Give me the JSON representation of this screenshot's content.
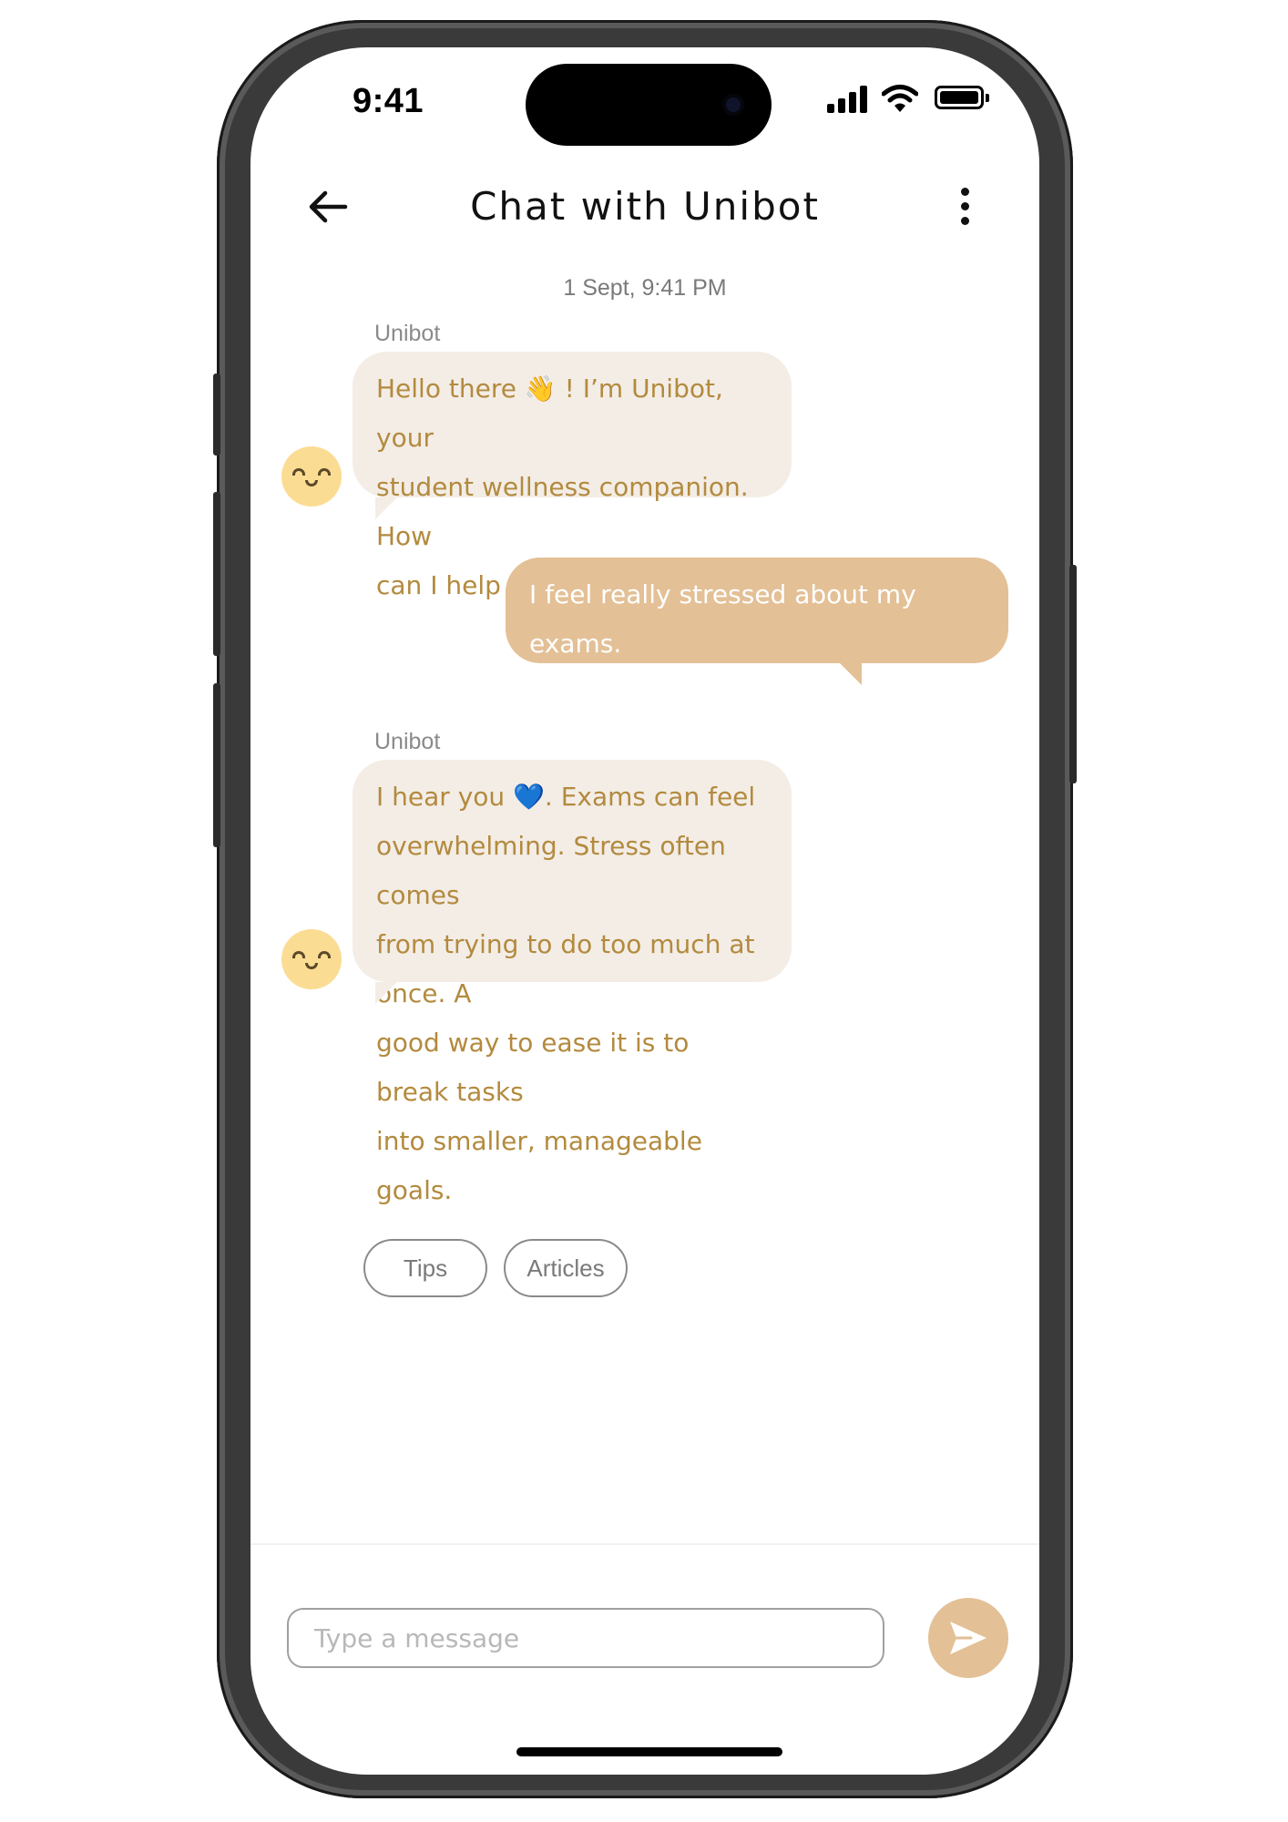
{
  "status_bar": {
    "time": "9:41"
  },
  "header": {
    "title": "Chat with Unibot"
  },
  "chat": {
    "timestamp": "1 Sept, 9:41 PM",
    "messages": [
      {
        "sender": "Unibot",
        "lines": [
          "Hello there 👋 ! I’m Unibot, your",
          "student wellness companion. How",
          "can I help you today?"
        ]
      },
      {
        "sender": "user",
        "lines": [
          "I feel really stressed about my",
          "exams."
        ]
      },
      {
        "sender": "Unibot",
        "lines": [
          "I hear you 💙. Exams can feel",
          "overwhelming. Stress often comes",
          "from trying to do too much at once. A",
          "good way to ease it is to break tasks",
          "into smaller, manageable goals."
        ]
      }
    ],
    "quick_replies": [
      "Tips",
      "Articles"
    ]
  },
  "composer": {
    "placeholder": "Type a message"
  },
  "colors": {
    "bot_bubble": "#f3ede6",
    "bot_text": "#b38a3e",
    "user_bubble": "#e3c096",
    "accent": "#e3c096",
    "avatar": "#fbdc93"
  }
}
